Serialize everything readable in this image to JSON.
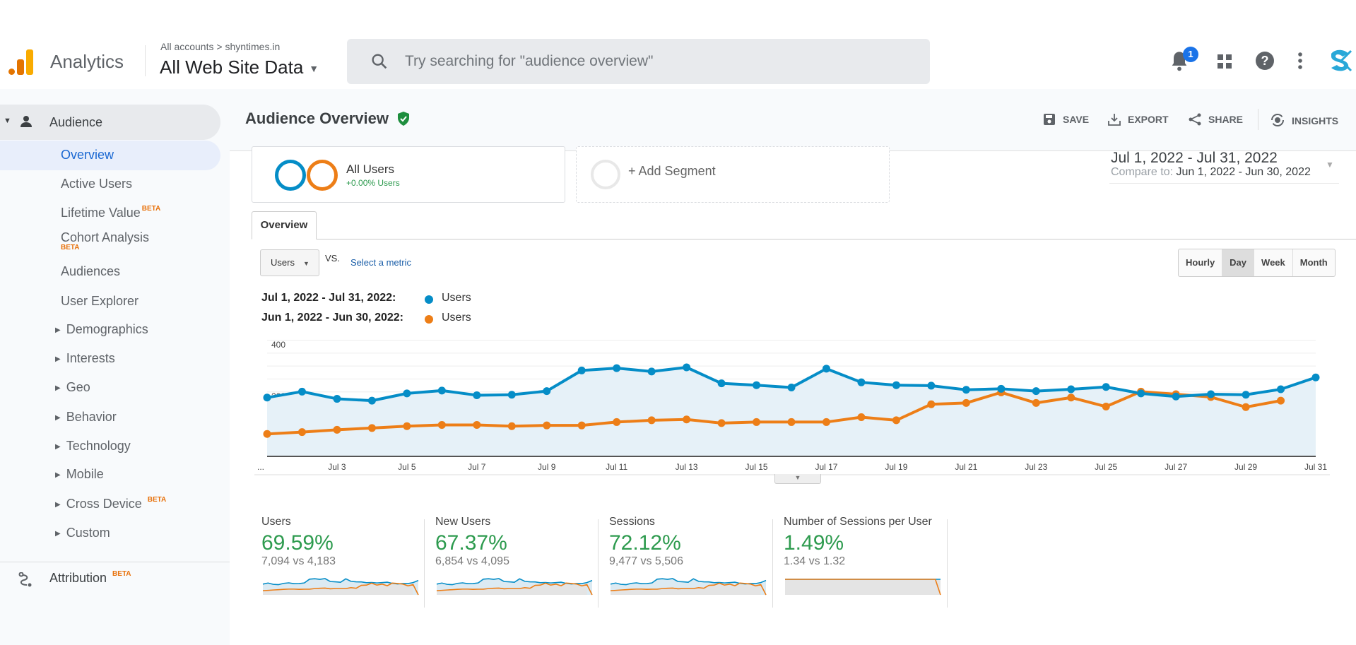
{
  "header": {
    "app_name": "Analytics",
    "breadcrumb": "All accounts > shyntimes.in",
    "view_name": "All Web Site Data",
    "search_placeholder": "Try searching for \"audience overview\"",
    "notification_count": "1"
  },
  "sidebar": {
    "section": "Audience",
    "items": [
      {
        "label": "Overview",
        "active": true
      },
      {
        "label": "Active Users"
      },
      {
        "label": "Lifetime Value",
        "badge": "BETA"
      },
      {
        "label": "Cohort Analysis",
        "badge": "BETA"
      },
      {
        "label": "Audiences"
      },
      {
        "label": "User Explorer"
      },
      {
        "label": "Demographics",
        "expandable": true
      },
      {
        "label": "Interests",
        "expandable": true
      },
      {
        "label": "Geo",
        "expandable": true
      },
      {
        "label": "Behavior",
        "expandable": true
      },
      {
        "label": "Technology",
        "expandable": true
      },
      {
        "label": "Mobile",
        "expandable": true
      },
      {
        "label": "Cross Device",
        "expandable": true,
        "badge": "BETA"
      },
      {
        "label": "Custom",
        "expandable": true
      }
    ],
    "attribution": {
      "label": "Attribution",
      "badge": "BETA"
    }
  },
  "page": {
    "title": "Audience Overview",
    "actions": {
      "save": "SAVE",
      "export": "EXPORT",
      "share": "SHARE",
      "insights": "INSIGHTS"
    },
    "segment": {
      "name": "All Users",
      "delta": "+0.00% Users"
    },
    "add_segment": "+ Add Segment",
    "date_range": "Jul 1, 2022 - Jul 31, 2022",
    "compare_label": "Compare to:",
    "compare_range": "Jun 1, 2022 - Jun 30, 2022",
    "tab": "Overview",
    "metric_select": "Users",
    "vs_label": "VS.",
    "select_metric": "Select a metric",
    "granularity": [
      "Hourly",
      "Day",
      "Week",
      "Month"
    ],
    "granularity_selected": "Day"
  },
  "colors": {
    "current": "#058dc7",
    "previous": "#ed7e17",
    "positive": "#2e9b4f"
  },
  "chart_data": {
    "type": "line",
    "title": "",
    "xlabel": "",
    "ylabel": "Users",
    "ylim": [
      0,
      460
    ],
    "yticks": [
      "200",
      "400"
    ],
    "x": [
      "Jul 1",
      "Jul 2",
      "Jul 3",
      "Jul 4",
      "Jul 5",
      "Jul 6",
      "Jul 7",
      "Jul 8",
      "Jul 9",
      "Jul 10",
      "Jul 11",
      "Jul 12",
      "Jul 13",
      "Jul 14",
      "Jul 15",
      "Jul 16",
      "Jul 17",
      "Jul 18",
      "Jul 19",
      "Jul 20",
      "Jul 21",
      "Jul 22",
      "Jul 23",
      "Jul 24",
      "Jul 25",
      "Jul 26",
      "Jul 27",
      "Jul 28",
      "Jul 29",
      "Jul 30",
      "Jul 31"
    ],
    "xtick_labels": [
      "...",
      "Jul 3",
      "Jul 5",
      "Jul 7",
      "Jul 9",
      "Jul 11",
      "Jul 13",
      "Jul 15",
      "Jul 17",
      "Jul 19",
      "Jul 21",
      "Jul 23",
      "Jul 25",
      "Jul 27",
      "Jul 29",
      "Jul 31"
    ],
    "legend": "top-left",
    "series": [
      {
        "name": "Users",
        "period": "Jul 1, 2022 - Jul 31, 2022:",
        "values": [
          228,
          251,
          223,
          216,
          244,
          255,
          237,
          239,
          253,
          333,
          342,
          329,
          345,
          283,
          276,
          267,
          340,
          287,
          276,
          274,
          258,
          262,
          253,
          260,
          269,
          244,
          232,
          241,
          239,
          260,
          306
        ]
      },
      {
        "name": "Users",
        "period": "Jun 1, 2022 - Jun 30, 2022:",
        "values": [
          87,
          94,
          103,
          110,
          117,
          122,
          122,
          117,
          120,
          120,
          133,
          140,
          143,
          129,
          133,
          133,
          133,
          152,
          140,
          202,
          207,
          248,
          207,
          228,
          193,
          251,
          241,
          230,
          191,
          216
        ]
      }
    ]
  },
  "scorecards": [
    {
      "title": "Users",
      "change": "69.59%",
      "compare": "7,094 vs 4,183"
    },
    {
      "title": "New Users",
      "change": "67.37%",
      "compare": "6,854 vs 4,095"
    },
    {
      "title": "Sessions",
      "change": "72.12%",
      "compare": "9,477 vs 5,506"
    },
    {
      "title": "Number of Sessions per User",
      "change": "1.49%",
      "compare": "1.34 vs 1.32"
    }
  ]
}
